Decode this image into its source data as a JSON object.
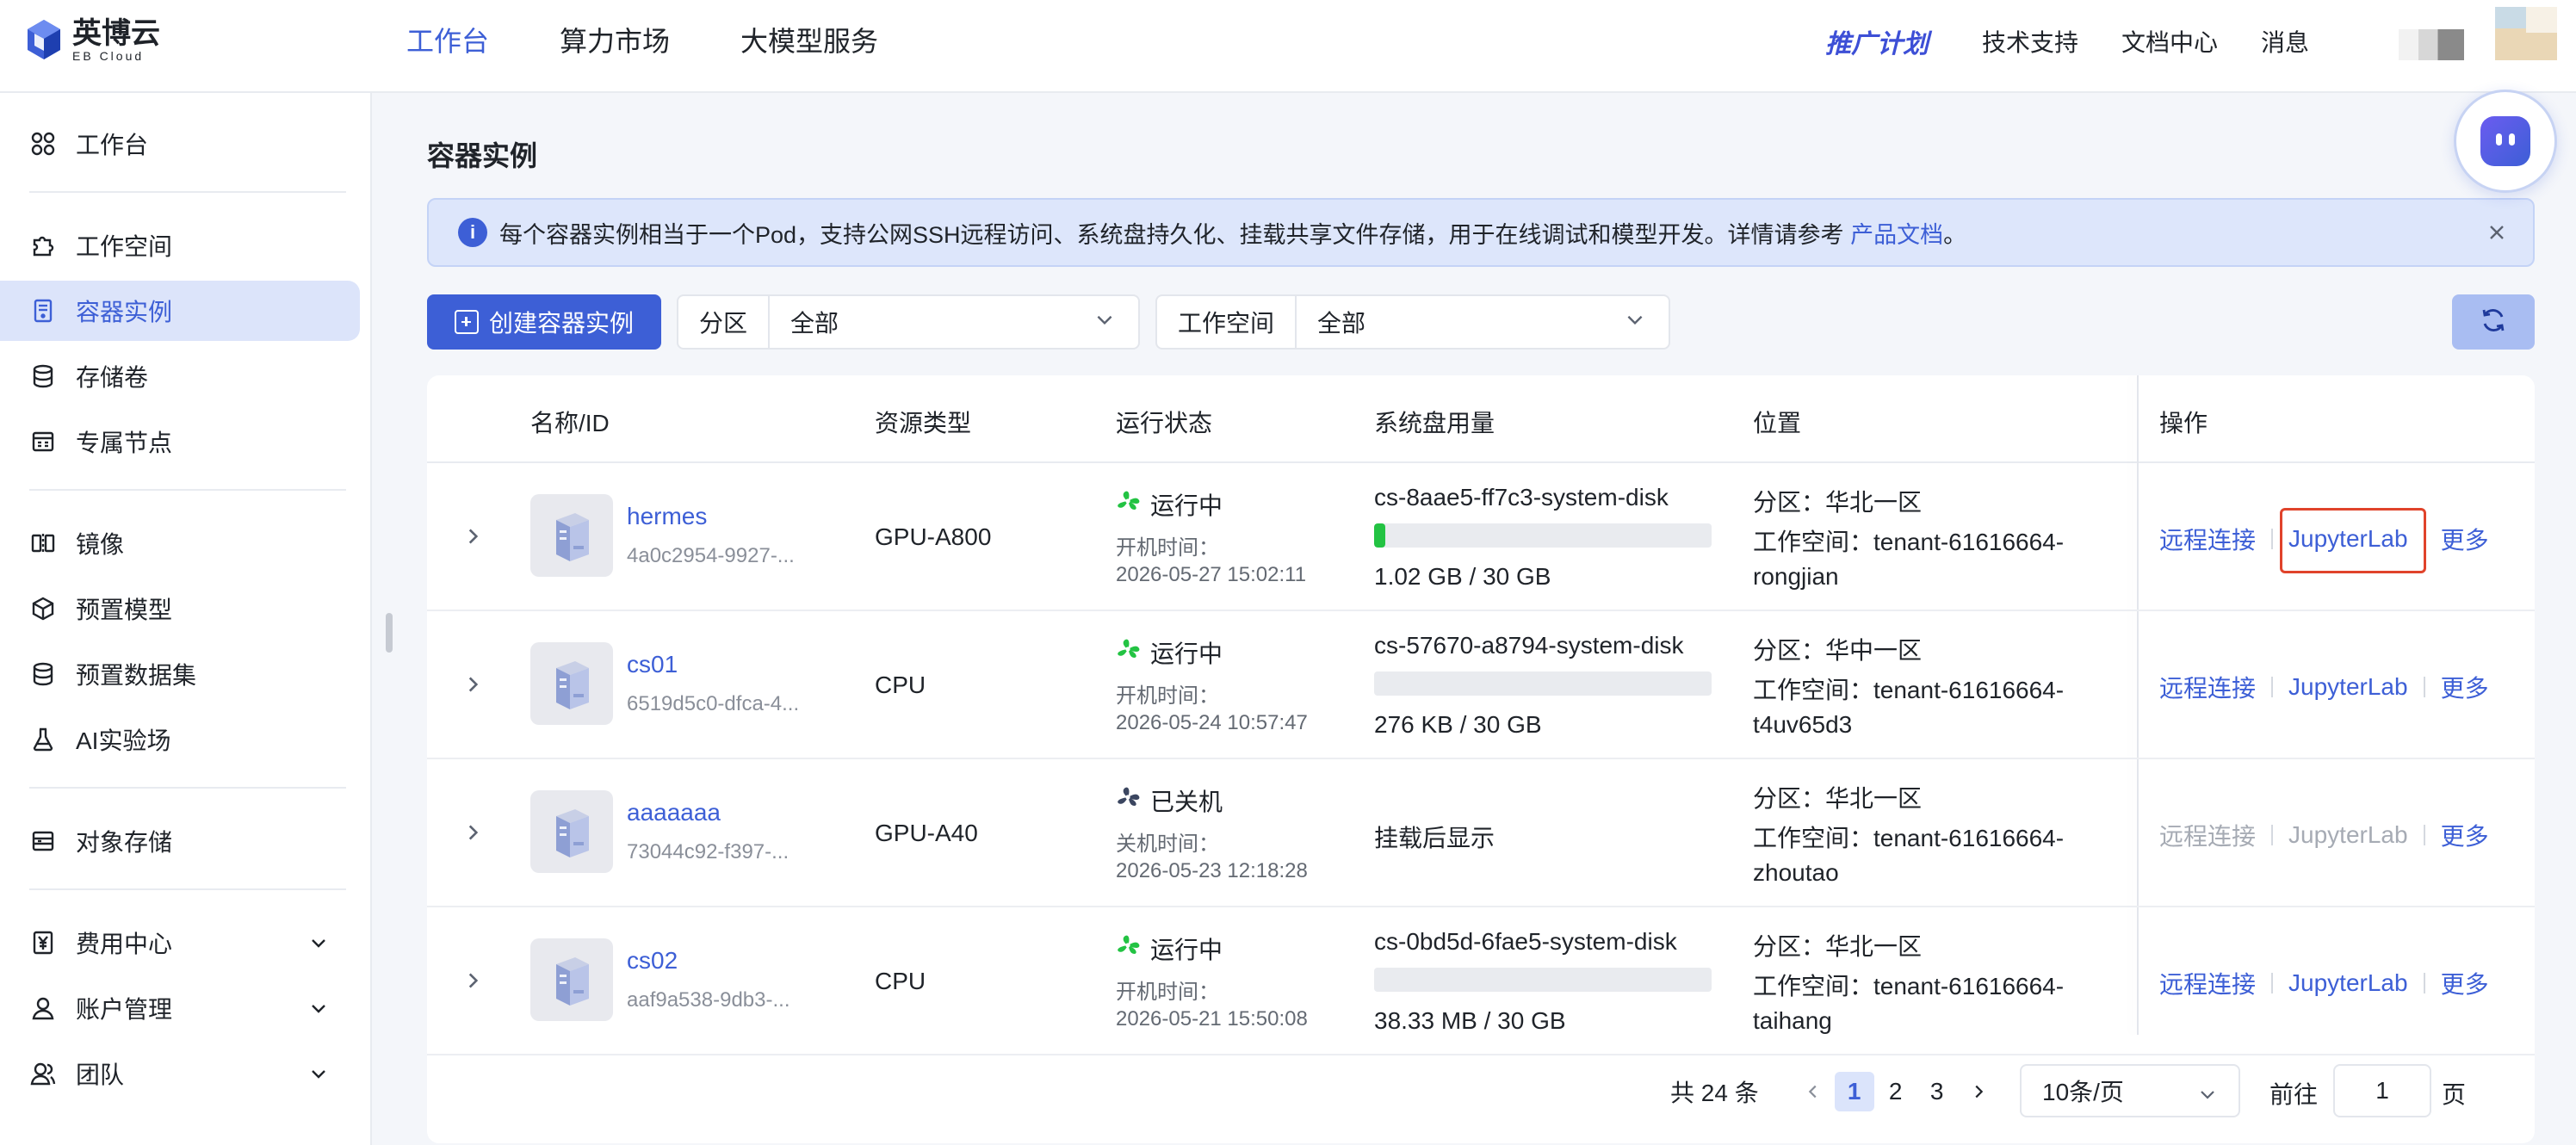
{
  "brand": {
    "name_cn": "英博云",
    "name_en": "EB Cloud"
  },
  "topnav": [
    {
      "label": "工作台",
      "active": true
    },
    {
      "label": "算力市场",
      "active": false
    },
    {
      "label": "大模型服务",
      "active": false
    }
  ],
  "topright": {
    "promo": "推广计划",
    "links": [
      "技术支持",
      "文档中心",
      "消息"
    ]
  },
  "sidebar": {
    "items": [
      {
        "label": "工作台",
        "icon": "grid-icon"
      },
      {
        "label": "工作空间",
        "icon": "puzzle-icon"
      },
      {
        "label": "容器实例",
        "icon": "container-icon",
        "active": true
      },
      {
        "label": "存储卷",
        "icon": "database-icon"
      },
      {
        "label": "专属节点",
        "icon": "node-icon"
      },
      {
        "label": "镜像",
        "icon": "mirror-icon"
      },
      {
        "label": "预置模型",
        "icon": "cube-icon"
      },
      {
        "label": "预置数据集",
        "icon": "dataset-icon"
      },
      {
        "label": "AI实验场",
        "icon": "flask-icon"
      },
      {
        "label": "对象存储",
        "icon": "bucket-icon"
      },
      {
        "label": "费用中心",
        "icon": "yen-icon"
      },
      {
        "label": "账户管理",
        "icon": "user-icon"
      },
      {
        "label": "团队",
        "icon": "team-icon"
      }
    ]
  },
  "page": {
    "title": "容器实例"
  },
  "notice": {
    "text": "每个容器实例相当于一个Pod，支持公网SSH远程访问、系统盘持久化、挂载共享文件存储，用于在线调试和模型开发。详情请参考",
    "link": "产品文档",
    "suffix": "。"
  },
  "toolbar": {
    "create_label": "创建容器实例",
    "zone_label": "分区",
    "zone_value": "全部",
    "workspace_label": "工作空间",
    "workspace_value": "全部"
  },
  "table": {
    "columns": [
      "名称/ID",
      "资源类型",
      "运行状态",
      "系统盘用量",
      "位置",
      "操作"
    ],
    "rows": [
      {
        "name": "hermes",
        "id": "4a0c2954-9927-...",
        "resource": "GPU-A800",
        "status": "运行中",
        "time_label": "开机时间：",
        "time": "2026-05-27 15:02:11",
        "running": true,
        "disk": "cs-8aae5-ff7c3-system-disk",
        "disk_usage": "1.02 GB / 30 GB",
        "disk_fill": 0.034,
        "zone": "分区：华北一区",
        "workspace": "工作空间：tenant-61616664-",
        "workspace2": "rongjian",
        "ops": [
          "远程连接",
          "JupyterLab",
          "更多"
        ]
      },
      {
        "name": "cs01",
        "id": "6519d5c0-dfca-4...",
        "resource": "CPU",
        "status": "运行中",
        "time_label": "开机时间：",
        "time": "2026-05-24 10:57:47",
        "running": true,
        "disk": "cs-57670-a8794-system-disk",
        "disk_usage": "276 KB / 30 GB",
        "disk_fill": 0.0,
        "zone": "分区：华中一区",
        "workspace": "工作空间：tenant-61616664-",
        "workspace2": "t4uv65d3",
        "ops": [
          "远程连接",
          "JupyterLab",
          "更多"
        ]
      },
      {
        "name": "aaaaaaa",
        "id": "73044c92-f397-...",
        "resource": "GPU-A40",
        "status": "已关机",
        "time_label": "关机时间：",
        "time": "2026-05-23 12:18:28",
        "running": false,
        "disk_none": "挂载后显示",
        "zone": "分区：华北一区",
        "workspace": "工作空间：tenant-61616664-",
        "workspace2": "zhoutao",
        "ops": [
          "远程连接",
          "JupyterLab",
          "更多"
        ]
      },
      {
        "name": "cs02",
        "id": "aaf9a538-9db3-...",
        "resource": "CPU",
        "status": "运行中",
        "time_label": "开机时间：",
        "time": "2026-05-21 15:50:08",
        "running": true,
        "disk": "cs-0bd5d-6fae5-system-disk",
        "disk_usage": "38.33 MB / 30 GB",
        "disk_fill": 0.001,
        "zone": "分区：华北一区",
        "workspace": "工作空间：tenant-61616664-",
        "workspace2": "taihang",
        "ops": [
          "远程连接",
          "JupyterLab",
          "更多"
        ]
      }
    ]
  },
  "pagination": {
    "total": "共 24 条",
    "pages": [
      "1",
      "2",
      "3"
    ],
    "current": "1",
    "page_size": "10条/页",
    "goto_label": "前往",
    "goto_value": "1",
    "goto_unit": "页"
  },
  "colors": {
    "accent": "#3d5fd6",
    "running": "#23c343",
    "highlight": "#e0432b"
  }
}
